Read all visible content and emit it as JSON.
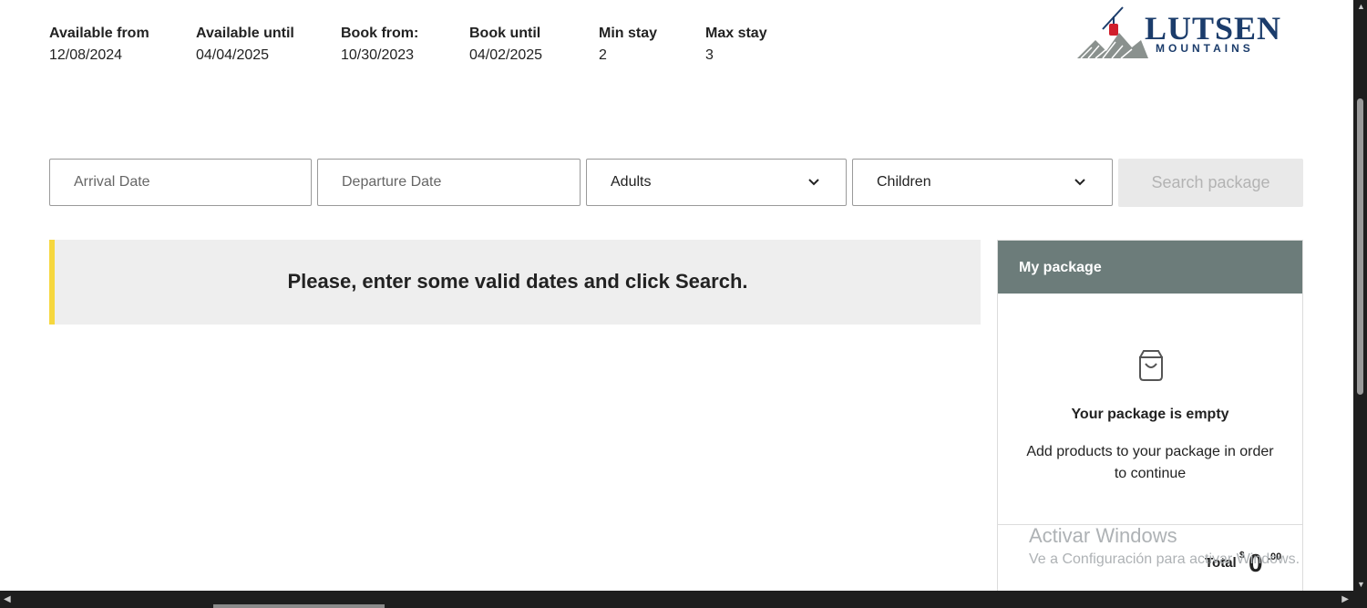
{
  "info": [
    {
      "label": "Available from",
      "value": "12/08/2024"
    },
    {
      "label": "Available until",
      "value": "04/04/2025"
    },
    {
      "label": "Book from:",
      "value": "10/30/2023"
    },
    {
      "label": "Book until",
      "value": "04/02/2025"
    },
    {
      "label": "Min stay",
      "value": "2"
    },
    {
      "label": "Max stay",
      "value": "3"
    }
  ],
  "logo": {
    "brand": "LUTSEN",
    "sub": "MOUNTAINS",
    "color": "#1b3c6b"
  },
  "search": {
    "arrival_placeholder": "Arrival Date",
    "departure_placeholder": "Departure Date",
    "adults_value": "Adults",
    "children_value": "Children",
    "button_label": "Search package"
  },
  "alert": {
    "message": "Please, enter some valid dates and click Search.",
    "accent": "#f6d73e"
  },
  "package": {
    "title": "My package",
    "header_color": "#6c7c7a",
    "empty_title": "Your package is empty",
    "empty_text": "Add products to your package in order to continue",
    "total_label": "Total",
    "currency": "$",
    "amount": "0",
    "cents": ".00"
  },
  "watermark": {
    "line1": "Activar Windows",
    "line2": "Ve a Configuración para activar Windows."
  }
}
